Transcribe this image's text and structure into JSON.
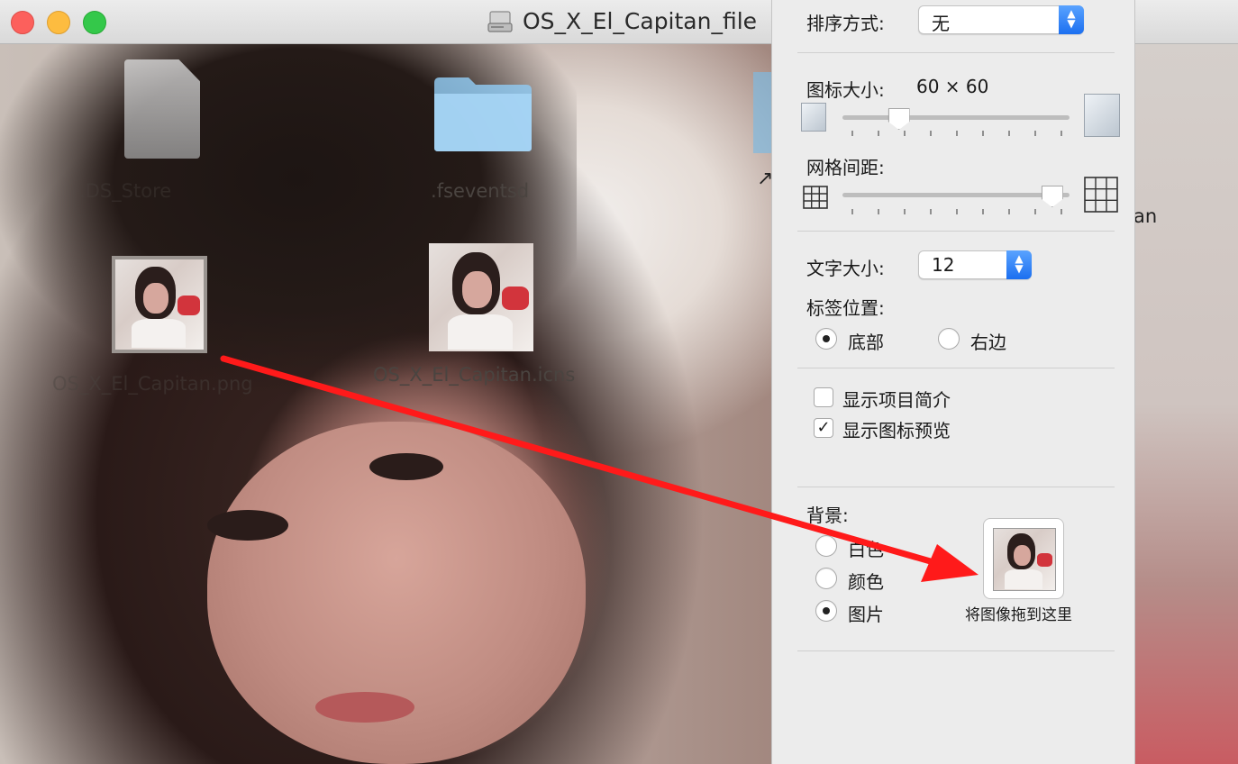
{
  "window": {
    "title": "OS_X_El_Capitan_file"
  },
  "desktop": {
    "items": [
      {
        "label": ".DS_Store",
        "icon": "document-icon"
      },
      {
        "label": ".fseventsd",
        "icon": "folder-icon"
      },
      {
        "label": "OS_X_El_Capitan.png",
        "icon": "image-file-icon"
      },
      {
        "label": "OS_X_El_Capitan.icns",
        "icon": "icns-file-icon"
      },
      {
        "label": "an",
        "icon": "alias-icon"
      }
    ]
  },
  "view_options": {
    "sort_label": "排序方式:",
    "sort_value": "无",
    "icon_size_label": "图标大小:",
    "icon_size_value": "60 × 60",
    "icon_size_slider_fraction": 0.22,
    "grid_spacing_label": "网格间距:",
    "grid_spacing_slider_fraction": 0.96,
    "text_size_label": "文字大小:",
    "text_size_value": "12",
    "label_position_label": "标签位置:",
    "label_position_options": [
      "底部",
      "右边"
    ],
    "label_position_selected": "底部",
    "show_item_info_label": "显示项目简介",
    "show_item_info_checked": false,
    "show_icon_preview_label": "显示图标预览",
    "show_icon_preview_checked": true,
    "background_label": "背景:",
    "background_options": [
      "白色",
      "颜色",
      "图片"
    ],
    "background_selected": "图片",
    "drop_image_label": "将图像拖到这里"
  },
  "colors": {
    "drag_arrow": "#ff1a1a",
    "popup_accent": "#1b6ff0"
  }
}
